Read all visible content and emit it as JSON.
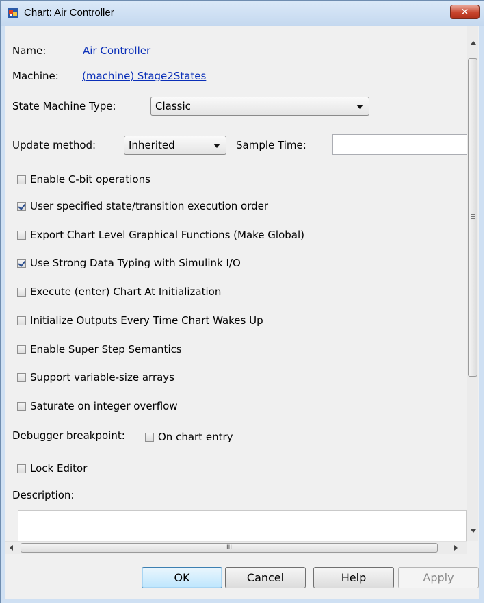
{
  "window": {
    "title": "Chart: Air Controller",
    "close_symbol": "✕",
    "app_icon": "simulink-chart-icon"
  },
  "fields": {
    "name_label": "Name:",
    "name_value": "Air Controller",
    "machine_label": "Machine:",
    "machine_value": "(machine) Stage2States",
    "state_machine_type_label": "State Machine Type:",
    "state_machine_type_value": "Classic",
    "update_method_label": "Update method:",
    "update_method_value": "Inherited",
    "sample_time_label": "Sample Time:",
    "sample_time_value": ""
  },
  "checkboxes": [
    {
      "label": "Enable C-bit operations",
      "checked": false
    },
    {
      "label": "User specified state/transition execution order",
      "checked": true
    },
    {
      "label": "Export Chart Level Graphical Functions (Make Global)",
      "checked": false
    },
    {
      "label": "Use Strong Data Typing with Simulink I/O",
      "checked": true
    },
    {
      "label": "Execute (enter) Chart At Initialization",
      "checked": false
    },
    {
      "label": "Initialize Outputs Every Time Chart Wakes Up",
      "checked": false
    },
    {
      "label": "Enable Super Step Semantics",
      "checked": false
    },
    {
      "label": "Support variable-size arrays",
      "checked": false
    },
    {
      "label": "Saturate on integer overflow",
      "checked": false
    }
  ],
  "debugger": {
    "label": "Debugger breakpoint:",
    "option_label": "On chart entry",
    "checked": false
  },
  "lock_editor": {
    "label": "Lock Editor",
    "checked": false
  },
  "description": {
    "label": "Description:",
    "value": ""
  },
  "hscroll_grip": "III",
  "buttons": {
    "ok": "OK",
    "cancel": "Cancel",
    "help": "Help",
    "apply": "Apply"
  }
}
